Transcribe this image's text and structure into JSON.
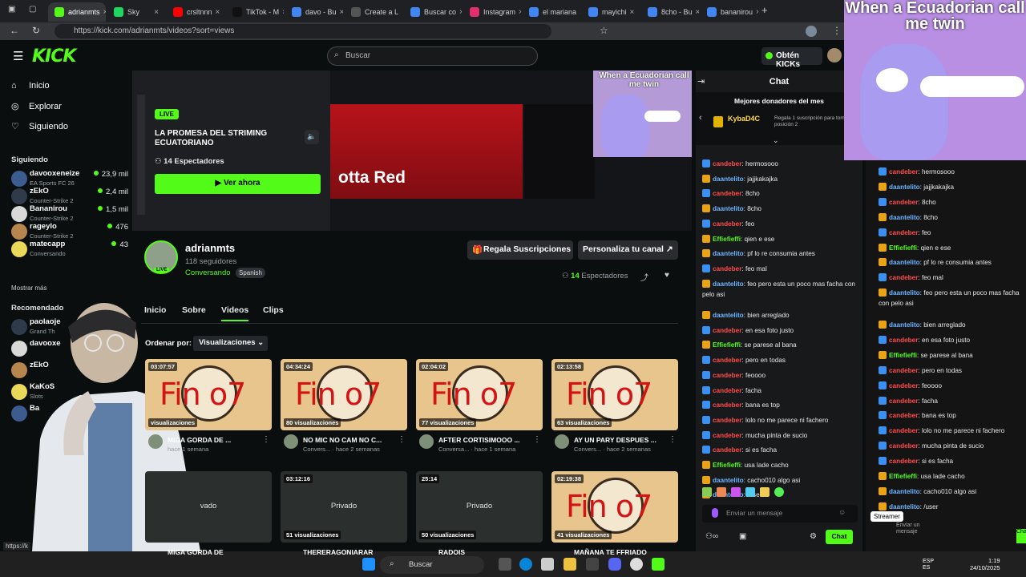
{
  "browser": {
    "tabs": [
      {
        "label": "adrianmts",
        "color": "#53fc18",
        "active": true
      },
      {
        "label": "Sky",
        "color": "#1ed760"
      },
      {
        "label": "crsltnnn",
        "color": "#ff0000"
      },
      {
        "label": "TikTok - M",
        "color": "#111111"
      },
      {
        "label": "davo - Bu",
        "color": "#4285f4"
      },
      {
        "label": "Create a L",
        "color": "#555555"
      },
      {
        "label": "Buscar co",
        "color": "#4285f4"
      },
      {
        "label": "Instagram",
        "color": "#e1306c"
      },
      {
        "label": "el mariana",
        "color": "#4285f4"
      },
      {
        "label": "mayichi",
        "color": "#4285f4"
      },
      {
        "label": "8cho - Bu",
        "color": "#4285f4"
      },
      {
        "label": "bananirou",
        "color": "#4285f4"
      }
    ],
    "url": "https://kick.com/adrianmts/videos?sort=views"
  },
  "header": {
    "logo": "KICK",
    "search_placeholder": "Buscar",
    "kicks_button": "Obtén KICKs"
  },
  "sidebar": {
    "nav": [
      {
        "label": "Inicio",
        "icon": "home-icon"
      },
      {
        "label": "Explorar",
        "icon": "compass-icon"
      },
      {
        "label": "Siguiendo",
        "icon": "heart-icon"
      }
    ],
    "following_title": "Siguiendo",
    "following": [
      {
        "name": "davooxeneize",
        "game": "EA Sports FC 26",
        "viewers": "23,9 mil"
      },
      {
        "name": "zEkO",
        "game": "Counter-Strike 2",
        "viewers": "2,4 mil"
      },
      {
        "name": "Bananirou",
        "game": "Counter-Strike 2",
        "viewers": "1,5 mil"
      },
      {
        "name": "rageylo",
        "game": "Counter-Strike 2",
        "viewers": "476"
      },
      {
        "name": "matecapp",
        "game": "Conversando",
        "viewers": "43"
      }
    ],
    "show_more": "Mostrar más",
    "recommended_title": "Recomendado",
    "recommended": [
      {
        "name": "paolaoje",
        "game": "Grand Th"
      },
      {
        "name": "davooxe",
        "game": ""
      },
      {
        "name": "zEkO",
        "game": ""
      },
      {
        "name": "KaKoS",
        "game": "Slots"
      },
      {
        "name": "Ba",
        "game": ""
      }
    ]
  },
  "hero": {
    "live_badge": "LIVE",
    "title": "LA PROMESA DEL STRIMING ECUATORIANO",
    "viewers": "14 Espectadores",
    "watch_button": "Ver ahora",
    "preview_text": "otta Red",
    "meme_caption": "When a Ecuadorian call me twin"
  },
  "channel": {
    "name": "adrianmts",
    "followers": "118 seguidores",
    "category": "Conversando",
    "language": "Spanish",
    "live_pill": "LIVE",
    "gift_button": "Regala Suscripciones",
    "customize_button": "Personaliza tu canal",
    "viewers_count": "14",
    "viewers_label": "Espectadores"
  },
  "tabs": [
    "Inicio",
    "Sobre",
    "Videos",
    "Clips"
  ],
  "sort": {
    "label": "Ordenar por:",
    "value": "Visualizaciones"
  },
  "videos": [
    {
      "duration": "03:07:57",
      "views": "visualizaciones",
      "title": "MIGA GORDA DE ...",
      "meta": "hace 1 semana",
      "private": false
    },
    {
      "duration": "04:34:24",
      "views": "80 visualizaciones",
      "title": "NO MIC NO CAM NO C...",
      "meta": "Convers... · hace 2 semanas",
      "private": false
    },
    {
      "duration": "02:04:02",
      "views": "77 visualizaciones",
      "title": "AFTER CORTISIMOOO ...",
      "meta": "Conversa... · hace 1 semana",
      "private": false
    },
    {
      "duration": "02:13:58",
      "views": "63 visualizaciones",
      "title": "AY UN PARY DESPUES ...",
      "meta": "Convers... · hace 2 semanas",
      "private": false
    },
    {
      "duration": "",
      "views": "",
      "title": "MIGA GORDA DE",
      "meta": "",
      "private": true,
      "private_label": "vado"
    },
    {
      "duration": "03:12:16",
      "views": "51 visualizaciones",
      "title": "THERERAGONIARAR",
      "meta": "",
      "private": true,
      "private_label": "Privado"
    },
    {
      "duration": "25:14",
      "views": "50 visualizaciones",
      "title": "RADOIS",
      "meta": "",
      "private": true,
      "private_label": "Privado"
    },
    {
      "duration": "02:19:38",
      "views": "41 visualizaciones",
      "title": "MAÑANA TE FFRIADO",
      "meta": "",
      "private": false
    }
  ],
  "video_thumb_text": "Fin o7",
  "chat": {
    "title": "Chat",
    "donors_title": "Mejores donadores del mes",
    "donor_name": "KybaD4C",
    "donor_hint": "Regala 1 suscripción para tomar la posición 2",
    "messages": [
      {
        "user": "candeber",
        "type": "u1",
        "text": ": hermosooo"
      },
      {
        "user": "daantelito",
        "type": "u2",
        "text": ": jajjkakajka"
      },
      {
        "user": "candeber",
        "type": "u1",
        "text": ": 8cho"
      },
      {
        "user": "daantelito",
        "type": "u2",
        "text": ": 8cho"
      },
      {
        "user": "candeber",
        "type": "u1",
        "text": ": feo"
      },
      {
        "user": "Effiefieffi",
        "type": "u3",
        "text": ": qien e ese"
      },
      {
        "user": "daantelito",
        "type": "u2",
        "text": ": pf lo re consumia antes"
      },
      {
        "user": "candeber",
        "type": "u1",
        "text": ": feo mal"
      },
      {
        "user": "daantelito",
        "type": "u2",
        "text": ": feo pero esta un poco mas facha con pelo asi"
      },
      {
        "user": "daantelito",
        "type": "u2",
        "text": ": bien arreglado"
      },
      {
        "user": "candeber",
        "type": "u1",
        "text": ": en esa foto justo"
      },
      {
        "user": "Effiefieffi",
        "type": "u3",
        "text": ": se parese al bana"
      },
      {
        "user": "candeber",
        "type": "u1",
        "text": ": pero en todas"
      },
      {
        "user": "candeber",
        "type": "u1",
        "text": ": feoooo"
      },
      {
        "user": "candeber",
        "type": "u1",
        "text": ": facha"
      },
      {
        "user": "candeber",
        "type": "u1",
        "text": ": bana es top"
      },
      {
        "user": "candeber",
        "type": "u1",
        "text": ": lolo no me parece ni fachero"
      },
      {
        "user": "candeber",
        "type": "u1",
        "text": ": mucha pinta de sucio"
      },
      {
        "user": "candeber",
        "type": "u1",
        "text": ": si es facha"
      },
      {
        "user": "Effiefieffi",
        "type": "u3",
        "text": ": usa lade cacho"
      },
      {
        "user": "daantelito",
        "type": "u2",
        "text": ": cacho010 algo asi"
      },
      {
        "user": "daantelito",
        "type": "u2",
        "text": ": /user"
      }
    ],
    "input_placeholder": "Enviar un mensaje",
    "send_button": "Chat"
  },
  "overlay": {
    "meme_caption": "When a Ecuadorian call me twin",
    "streamer_label": "Streamer",
    "send_label": "Enviar un mensaje",
    "chat_button": "Chat"
  },
  "taskbar": {
    "search": "Buscar",
    "lang": "ESP ES",
    "time": "1:19",
    "date": "24/10/2025"
  },
  "status_url": "https://k"
}
